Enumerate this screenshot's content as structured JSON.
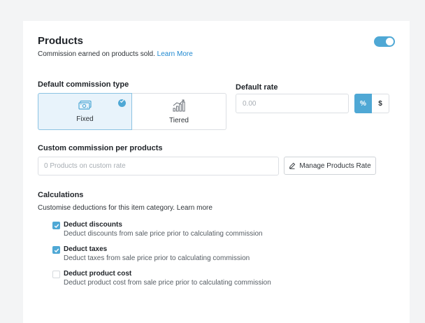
{
  "header": {
    "title": "Products",
    "subtitle": "Commission earned on products sold.",
    "learn_more": "Learn More",
    "toggle_on": true
  },
  "commission_type": {
    "label": "Default commission type",
    "options": [
      {
        "label": "Fixed",
        "icon": "cash-icon",
        "selected": true
      },
      {
        "label": "Tiered",
        "icon": "tiered-chart-icon",
        "selected": false
      }
    ]
  },
  "default_rate": {
    "label": "Default rate",
    "placeholder": "0.00",
    "units": [
      "%",
      "$"
    ],
    "selected_unit": "%"
  },
  "custom_commission": {
    "label": "Custom commission per products",
    "placeholder": "0 Products on custom rate",
    "manage_button": "Manage Products Rate"
  },
  "calculations": {
    "label": "Calculations",
    "description": "Customise deductions for this item category.",
    "learn_more": "Learn more",
    "options": [
      {
        "title": "Deduct discounts",
        "description": "Deduct discounts from sale price prior to calculating commission",
        "checked": true
      },
      {
        "title": "Deduct taxes",
        "description": "Deduct taxes from sale price prior to calculating commission",
        "checked": true
      },
      {
        "title": "Deduct product cost",
        "description": "Deduct product cost from sale price prior to calculating commission",
        "checked": false
      }
    ]
  },
  "colors": {
    "accent": "#4fa8d5",
    "link": "#1e88d0",
    "selected_bg": "#e8f3fb"
  }
}
